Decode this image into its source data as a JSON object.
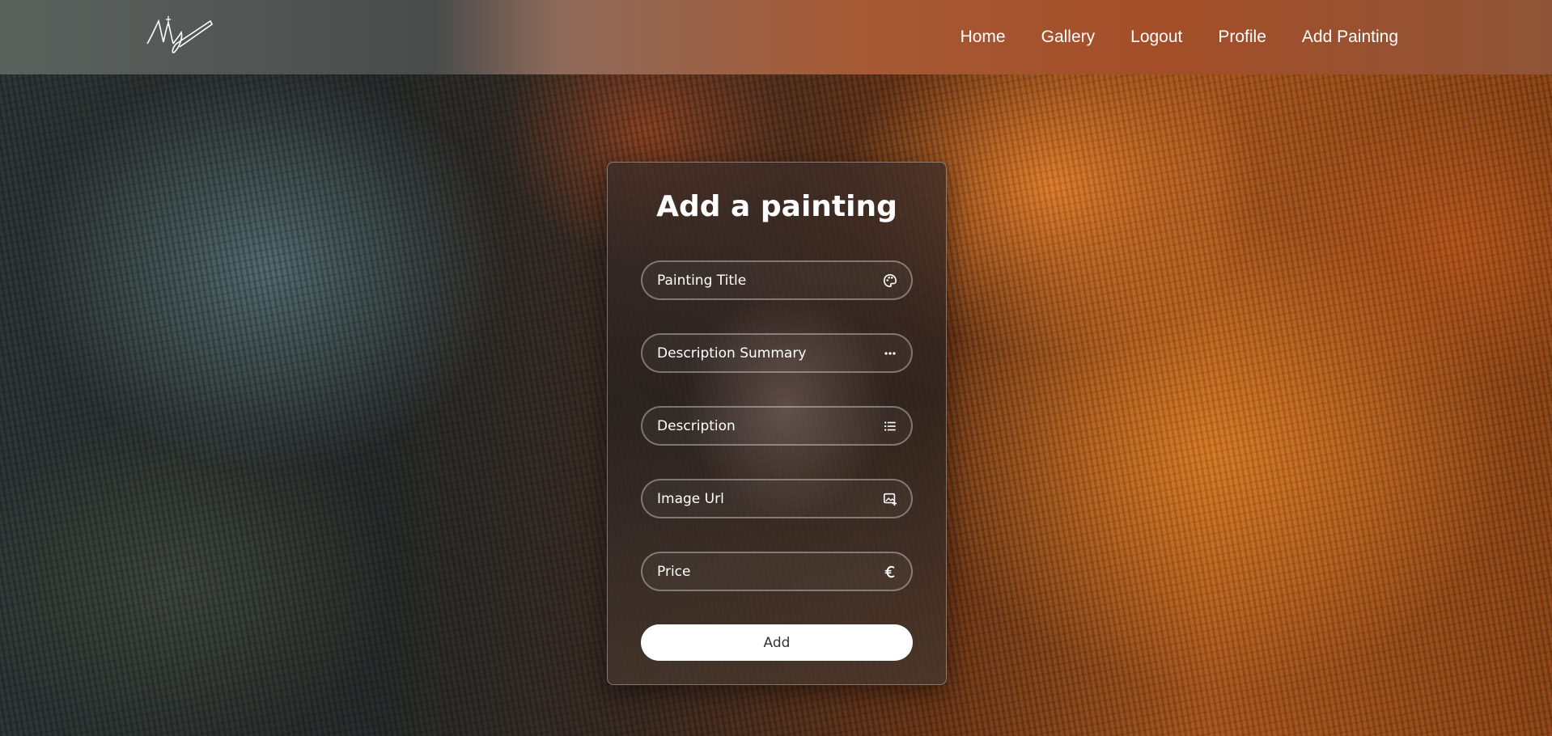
{
  "nav": {
    "logo_text": "Art",
    "links": [
      "Home",
      "Gallery",
      "Logout",
      "Profile",
      "Add Painting"
    ]
  },
  "form": {
    "title": "Add a painting",
    "fields": [
      {
        "placeholder": "Painting Title",
        "icon": "palette-icon"
      },
      {
        "placeholder": "Description Summary",
        "icon": "ellipsis-icon"
      },
      {
        "placeholder": "Description",
        "icon": "list-icon"
      },
      {
        "placeholder": "Image Url",
        "icon": "image-add-icon"
      },
      {
        "placeholder": "Price",
        "icon": "euro-icon"
      }
    ],
    "submit_label": "Add"
  },
  "colors": {
    "accent_white": "#ffffff",
    "button_text": "#333333"
  }
}
